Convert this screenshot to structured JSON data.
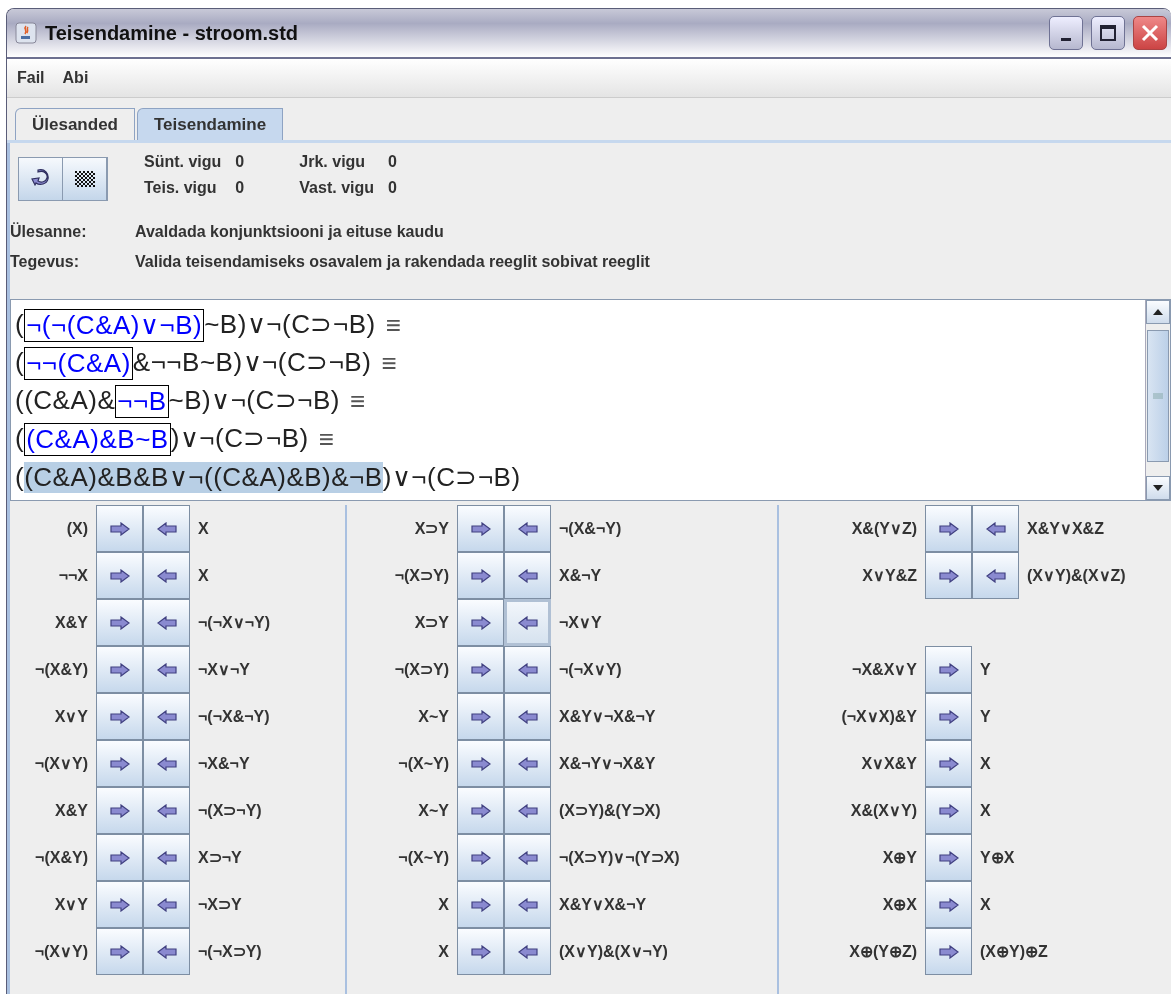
{
  "window": {
    "title": "Teisendamine - stroom.std"
  },
  "menu": [
    "Fail",
    "Abi"
  ],
  "tabs": [
    {
      "label": "Ülesanded",
      "selected": false
    },
    {
      "label": "Teisendamine",
      "selected": true
    }
  ],
  "counters": [
    {
      "label": "Sünt. vigu",
      "value": "0"
    },
    {
      "label": "Jrk. vigu",
      "value": "0"
    },
    {
      "label": "Teis. vigu",
      "value": "0"
    },
    {
      "label": "Vast. vigu",
      "value": "0"
    }
  ],
  "task": {
    "label": "Ülesanne:",
    "text": "Avaldada konjunktsiooni ja eituse kaudu"
  },
  "action": {
    "label": "Tegevus:",
    "text": "Valida teisendamiseks osavalem ja rakendada reeglit sobivat reeglit"
  },
  "derivation": [
    {
      "segments": [
        {
          "kind": "plain",
          "text": "("
        },
        {
          "kind": "boxed",
          "text": "¬(¬(C&A)∨¬B)"
        },
        {
          "kind": "plain",
          "text": "~B)∨¬(C⊃¬B)"
        }
      ],
      "mark": "≡"
    },
    {
      "segments": [
        {
          "kind": "plain",
          "text": "("
        },
        {
          "kind": "boxed",
          "text": "¬¬(C&A)"
        },
        {
          "kind": "plain",
          "text": "&¬¬B~B)∨¬(C⊃¬B)"
        }
      ],
      "mark": "≡"
    },
    {
      "segments": [
        {
          "kind": "plain",
          "text": "((C&A)&"
        },
        {
          "kind": "boxed",
          "text": "¬¬B"
        },
        {
          "kind": "plain",
          "text": "~B)∨¬(C⊃¬B)"
        }
      ],
      "mark": "≡"
    },
    {
      "segments": [
        {
          "kind": "plain",
          "text": "("
        },
        {
          "kind": "boxed",
          "text": "(C&A)&B~B"
        },
        {
          "kind": "plain",
          "text": ")∨¬(C⊃¬B)"
        }
      ],
      "mark": "≡"
    },
    {
      "segments": [
        {
          "kind": "plain",
          "text": "("
        },
        {
          "kind": "selected",
          "text": "(C&A)&B&B∨¬((C&A)&B)&¬B"
        },
        {
          "kind": "plain",
          "text": ")∨¬(C⊃¬B)"
        }
      ]
    }
  ],
  "rule_columns": [
    {
      "rules": [
        {
          "kind": "two_way",
          "left": "(X)",
          "right": "X",
          "back_focused": false
        },
        {
          "kind": "two_way",
          "left": "¬¬X",
          "right": "X",
          "back_focused": false
        },
        {
          "kind": "two_way",
          "left": "X&Y",
          "right": "¬(¬X∨¬Y)",
          "back_focused": false
        },
        {
          "kind": "two_way",
          "left": "¬(X&Y)",
          "right": "¬X∨¬Y",
          "back_focused": false
        },
        {
          "kind": "two_way",
          "left": "X∨Y",
          "right": "¬(¬X&¬Y)",
          "back_focused": false
        },
        {
          "kind": "two_way",
          "left": "¬(X∨Y)",
          "right": "¬X&¬Y",
          "back_focused": false
        },
        {
          "kind": "two_way",
          "left": "X&Y",
          "right": "¬(X⊃¬Y)",
          "back_focused": false
        },
        {
          "kind": "two_way",
          "left": "¬(X&Y)",
          "right": "X⊃¬Y",
          "back_focused": false
        },
        {
          "kind": "two_way",
          "left": "X∨Y",
          "right": "¬X⊃Y",
          "back_focused": false
        },
        {
          "kind": "two_way",
          "left": "¬(X∨Y)",
          "right": "¬(¬X⊃Y)",
          "back_focused": false
        }
      ]
    },
    {
      "rules": [
        {
          "kind": "two_way",
          "left": "X⊃Y",
          "right": "¬(X&¬Y)",
          "back_focused": false
        },
        {
          "kind": "two_way",
          "left": "¬(X⊃Y)",
          "right": "X&¬Y",
          "back_focused": false
        },
        {
          "kind": "two_way",
          "left": "X⊃Y",
          "right": "¬X∨Y",
          "back_focused": true
        },
        {
          "kind": "two_way",
          "left": "¬(X⊃Y)",
          "right": "¬(¬X∨Y)",
          "back_focused": false
        },
        {
          "kind": "two_way",
          "left": "X~Y",
          "right": "X&Y∨¬X&¬Y",
          "back_focused": false
        },
        {
          "kind": "two_way",
          "left": "¬(X~Y)",
          "right": "X&¬Y∨¬X&Y",
          "back_focused": false
        },
        {
          "kind": "two_way",
          "left": "X~Y",
          "right": "(X⊃Y)&(Y⊃X)",
          "back_focused": false
        },
        {
          "kind": "two_way",
          "left": "¬(X~Y)",
          "right": "¬(X⊃Y)∨¬(Y⊃X)",
          "back_focused": false
        },
        {
          "kind": "two_way",
          "left": "X",
          "right": "X&Y∨X&¬Y",
          "back_focused": false
        },
        {
          "kind": "two_way",
          "left": "X",
          "right": "(X∨Y)&(X∨¬Y)",
          "back_focused": false
        }
      ]
    },
    {
      "rules": [
        {
          "kind": "two_way",
          "left": "X&(Y∨Z)",
          "right": "X&Y∨X&Z",
          "back_focused": false
        },
        {
          "kind": "two_way",
          "left": "X∨Y&Z",
          "right": "(X∨Y)&(X∨Z)",
          "back_focused": false
        },
        {
          "kind": "gap"
        },
        {
          "kind": "one_way",
          "left": "¬X&X∨Y",
          "right": "Y"
        },
        {
          "kind": "one_way",
          "left": "(¬X∨X)&Y",
          "right": "Y"
        },
        {
          "kind": "one_way",
          "left": "X∨X&Y",
          "right": "X"
        },
        {
          "kind": "one_way",
          "left": "X&(X∨Y)",
          "right": "X"
        },
        {
          "kind": "one_way",
          "left": "X⊕Y",
          "right": "Y⊕X"
        },
        {
          "kind": "one_way",
          "left": "X⊕X",
          "right": "X"
        },
        {
          "kind": "one_way",
          "left": "X⊕(Y⊕Z)",
          "right": "(X⊕Y)⊕Z"
        }
      ]
    }
  ]
}
